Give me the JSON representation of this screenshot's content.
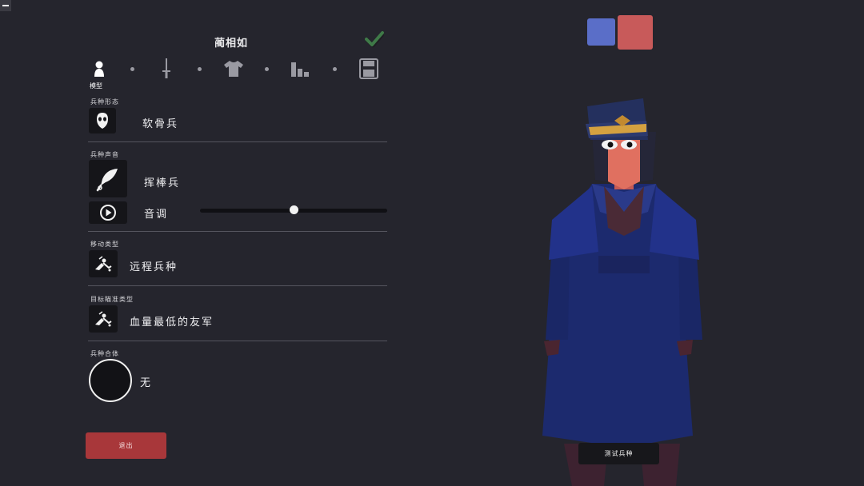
{
  "editor": {
    "unit_name": "蔺相如",
    "tabs": [
      {
        "icon": "person-icon",
        "label": "模型"
      },
      {
        "icon": "sword-icon",
        "label": ""
      },
      {
        "icon": "shirt-icon",
        "label": ""
      },
      {
        "icon": "stats-icon",
        "label": ""
      },
      {
        "icon": "save-icon",
        "label": ""
      }
    ],
    "sections": {
      "unit_base": {
        "label": "兵种形态",
        "value": "软骨兵",
        "icon": "mask-icon"
      },
      "unit_voice": {
        "label": "兵种声音",
        "value": "挥棒兵",
        "icon": "feather-icon",
        "pitch_label": "音调",
        "pitch_value": 0.5
      },
      "movement": {
        "label": "移动类型",
        "value": "远程兵种",
        "icon": "ranged-unit-icon"
      },
      "targeting": {
        "label": "目标瞄准类型",
        "value": "血量最低的友军",
        "icon": "target-unit-icon"
      },
      "combine": {
        "label": "兵种合体",
        "value": "无"
      }
    },
    "exit_label": "退出"
  },
  "preview": {
    "team_colors": [
      "#5a6ec8",
      "#c85a5a"
    ],
    "test_label": "测试兵种"
  }
}
